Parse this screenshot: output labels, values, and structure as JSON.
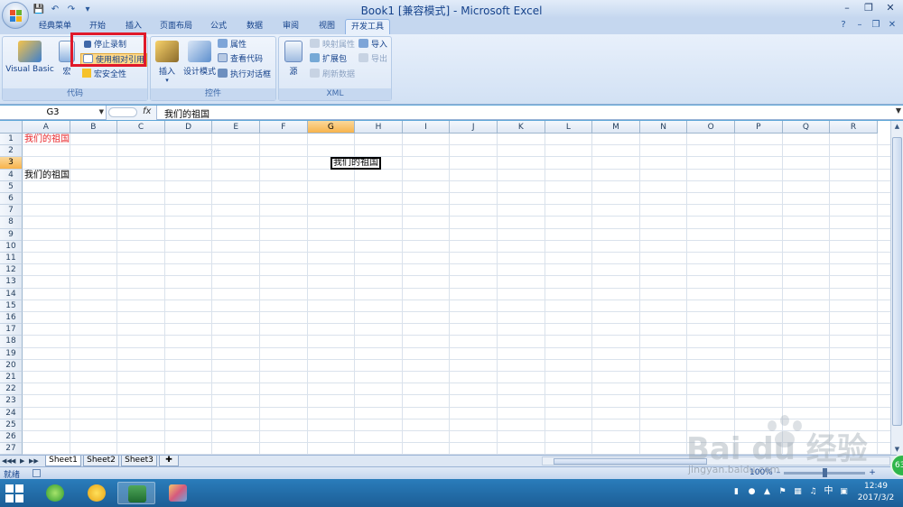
{
  "window": {
    "title": "Book1  [兼容模式] - Microsoft Excel",
    "quick_access": [
      "save-icon",
      "undo-icon",
      "redo-icon",
      "customize-icon"
    ]
  },
  "tabs": [
    "经典菜单",
    "开始",
    "插入",
    "页面布局",
    "公式",
    "数据",
    "审阅",
    "视图",
    "开发工具"
  ],
  "active_tab": "开发工具",
  "ribbon": {
    "code_group": {
      "label": "代码",
      "visual_basic": "Visual Basic",
      "macro": "宏",
      "stop_recording": "停止录制",
      "relative_ref": "使用相对引用",
      "macro_security": "宏安全性"
    },
    "controls_group": {
      "label": "控件",
      "insert": "插入",
      "design_mode": "设计模式",
      "properties": "属性",
      "view_code": "查看代码",
      "run_dialog": "执行对话框"
    },
    "xml_group": {
      "label": "XML",
      "source": "源",
      "map_properties": "映射属性",
      "expansion_pack": "扩展包",
      "refresh_data": "刷新数据",
      "import": "导入",
      "export": "导出"
    }
  },
  "formula_bar": {
    "name_box": "G3",
    "fx": "fx",
    "content": "我们的祖国"
  },
  "grid": {
    "columns": [
      "A",
      "B",
      "C",
      "D",
      "E",
      "F",
      "G",
      "H",
      "I",
      "J",
      "K",
      "L",
      "M",
      "N",
      "O",
      "P",
      "Q",
      "R"
    ],
    "rows": [
      "1",
      "2",
      "3",
      "4",
      "5",
      "6",
      "7",
      "8",
      "9",
      "10",
      "11",
      "12",
      "13",
      "14",
      "15",
      "16",
      "17",
      "18",
      "19",
      "20",
      "21",
      "22",
      "23",
      "24",
      "25",
      "26",
      "27"
    ],
    "selected_column": "G",
    "selected_row": "3",
    "cells": {
      "A1": "我们的祖国",
      "A4": "我们的祖国",
      "G3": "我们的祖国"
    },
    "colors": {
      "A1": "#e8262a"
    }
  },
  "sheets": [
    "Sheet1",
    "Sheet2",
    "Sheet3"
  ],
  "active_sheet": "Sheet1",
  "status": {
    "ready": "就绪",
    "zoom_level": 100,
    "zoom_text": "100%"
  },
  "taskbar": {
    "time": "12:49",
    "date": "2017/3/2",
    "ime": "中"
  },
  "watermark": {
    "logo": "Bai du 经验",
    "url": "jingyan.baidu.com"
  },
  "badge": "63"
}
